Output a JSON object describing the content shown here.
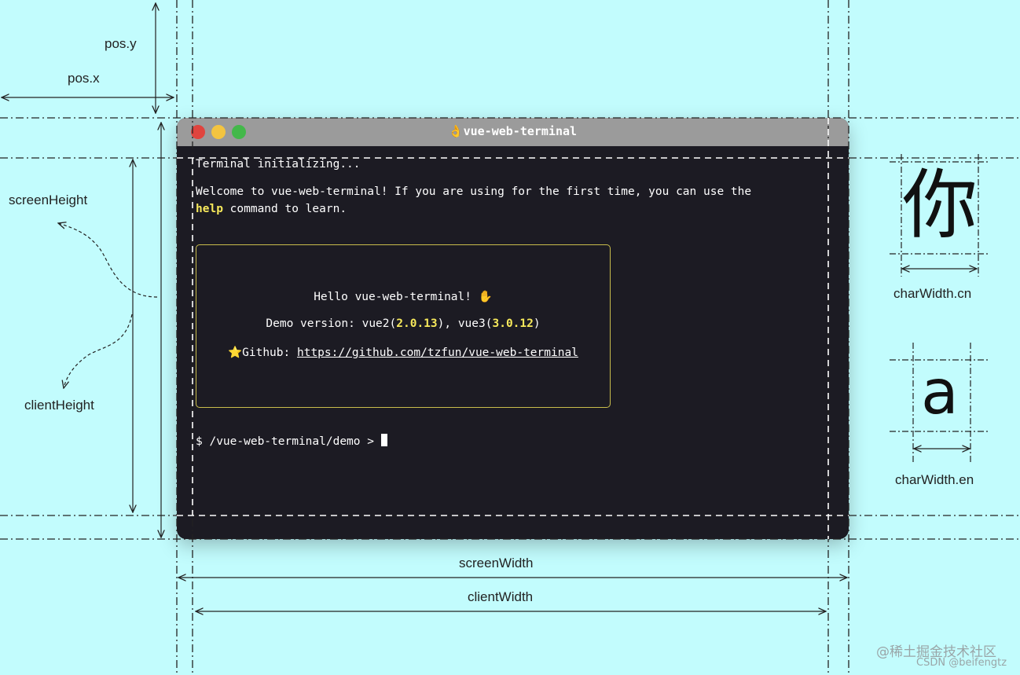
{
  "terminal": {
    "title": "👌vue-web-terminal",
    "line_init": "Terminal initializing...",
    "welcome_1": "Welcome to vue-web-terminal! If you are using for the first time, you can use the",
    "welcome_help": "help",
    "welcome_2": " command to learn.",
    "box_hello": "Hello vue-web-terminal! ✋",
    "demo_prefix": "Demo version: vue2(",
    "demo_vue2": "2.0.13",
    "demo_mid": "), vue3(",
    "demo_vue3": "3.0.12",
    "demo_suffix": ")",
    "github_prefix": "⭐Github: ",
    "github_link": "https://github.com/tzfun/vue-web-terminal",
    "prompt": "$ /vue-web-terminal/demo > "
  },
  "labels": {
    "pos_y": "pos.y",
    "pos_x": "pos.x",
    "screen_height": "screenHeight",
    "client_height": "clientHeight",
    "screen_width": "screenWidth",
    "client_width": "clientWidth",
    "char_width_cn": "charWidth.cn",
    "char_width_en": "charWidth.en"
  },
  "chars": {
    "cn": "你",
    "en": "a"
  },
  "watermark": {
    "line1": "@稀土掘金技术社区",
    "line2": "CSDN @beifengtz"
  },
  "colors": {
    "background": "#c2fcfd",
    "terminal_bg": "#1c1b23",
    "highlight": "#f7e95b"
  }
}
